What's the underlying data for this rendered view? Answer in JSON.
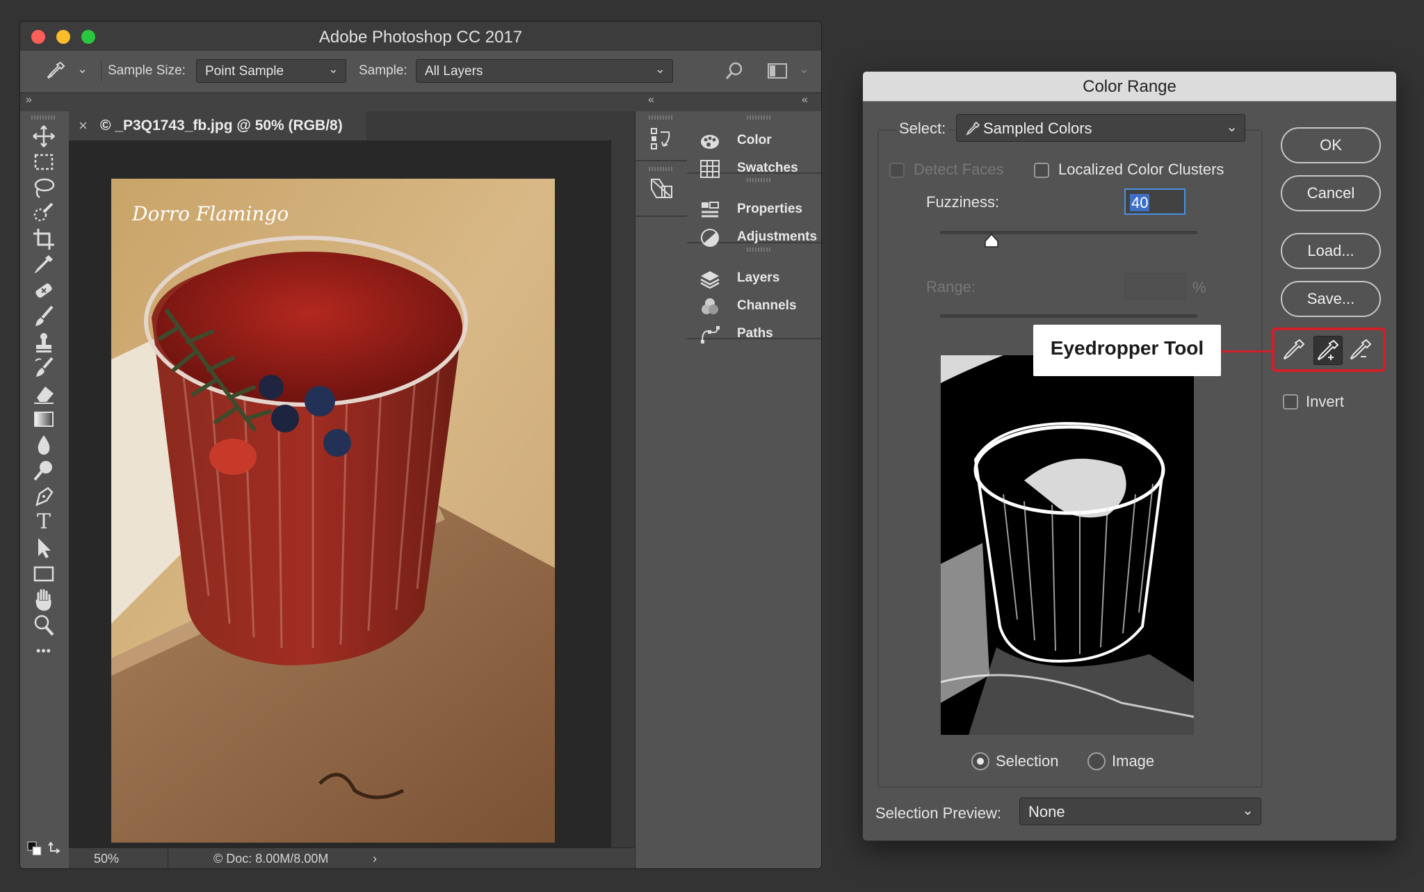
{
  "photoshop": {
    "title": "Adobe Photoshop CC 2017",
    "options_bar": {
      "tool_icon": "eyedropper-icon",
      "sample_size_label": "Sample Size:",
      "sample_size_value": "Point Sample",
      "sample_label": "Sample:",
      "sample_value": "All Layers"
    },
    "document": {
      "tab_close": "×",
      "tab_title": "© _P3Q1743_fb.jpg @ 50% (RGB/8)",
      "zoom": "50%",
      "doc_info": "© Doc: 8.00M/8.00M",
      "status_arrow": "›"
    },
    "tools": [
      "move-icon",
      "marquee-icon",
      "lasso-icon",
      "quick-selection-icon",
      "crop-icon",
      "eyedropper-icon",
      "healing-brush-icon",
      "brush-icon",
      "clone-stamp-icon",
      "history-brush-icon",
      "eraser-icon",
      "gradient-icon",
      "blur-icon",
      "dodge-icon",
      "pen-icon",
      "type-icon",
      "path-selection-icon",
      "rectangle-icon",
      "hand-icon",
      "zoom-icon",
      "more-tools-icon"
    ],
    "type_tool_glyph": "T",
    "more_tools_glyph": "•••",
    "collapse_glyph": "»",
    "panel_collapse_glyph": "«",
    "panels": [
      {
        "icon": "color-icon",
        "label": "Color"
      },
      {
        "icon": "swatches-icon",
        "label": "Swatches"
      },
      {
        "icon": "properties-icon",
        "label": "Properties"
      },
      {
        "icon": "adjustments-icon",
        "label": "Adjustments"
      },
      {
        "icon": "layers-icon",
        "label": "Layers"
      },
      {
        "icon": "channels-icon",
        "label": "Channels"
      },
      {
        "icon": "paths-icon",
        "label": "Paths"
      }
    ],
    "image_signature": "Dorro Flamingo"
  },
  "color_range": {
    "title": "Color Range",
    "select_label": "Select:",
    "select_value": "Sampled Colors",
    "detect_faces_label": "Detect Faces",
    "detect_faces_checked": false,
    "localized_label": "Localized Color Clusters",
    "localized_checked": false,
    "fuzziness_label": "Fuzziness:",
    "fuzziness_value": "40",
    "range_label": "Range:",
    "range_value": "",
    "range_unit": "%",
    "selection_label": "Selection",
    "image_label": "Image",
    "selected_radio": "Selection",
    "preview_label": "Selection Preview:",
    "preview_value": "None",
    "buttons": {
      "ok": "OK",
      "cancel": "Cancel",
      "load": "Load...",
      "save": "Save..."
    },
    "invert_label": "Invert",
    "invert_checked": false,
    "callout": "Eyedropper Tool",
    "eyedroppers": [
      "eyedropper-icon",
      "eyedropper-add-icon",
      "eyedropper-subtract-icon"
    ],
    "highlight_color": "#d0202a"
  }
}
